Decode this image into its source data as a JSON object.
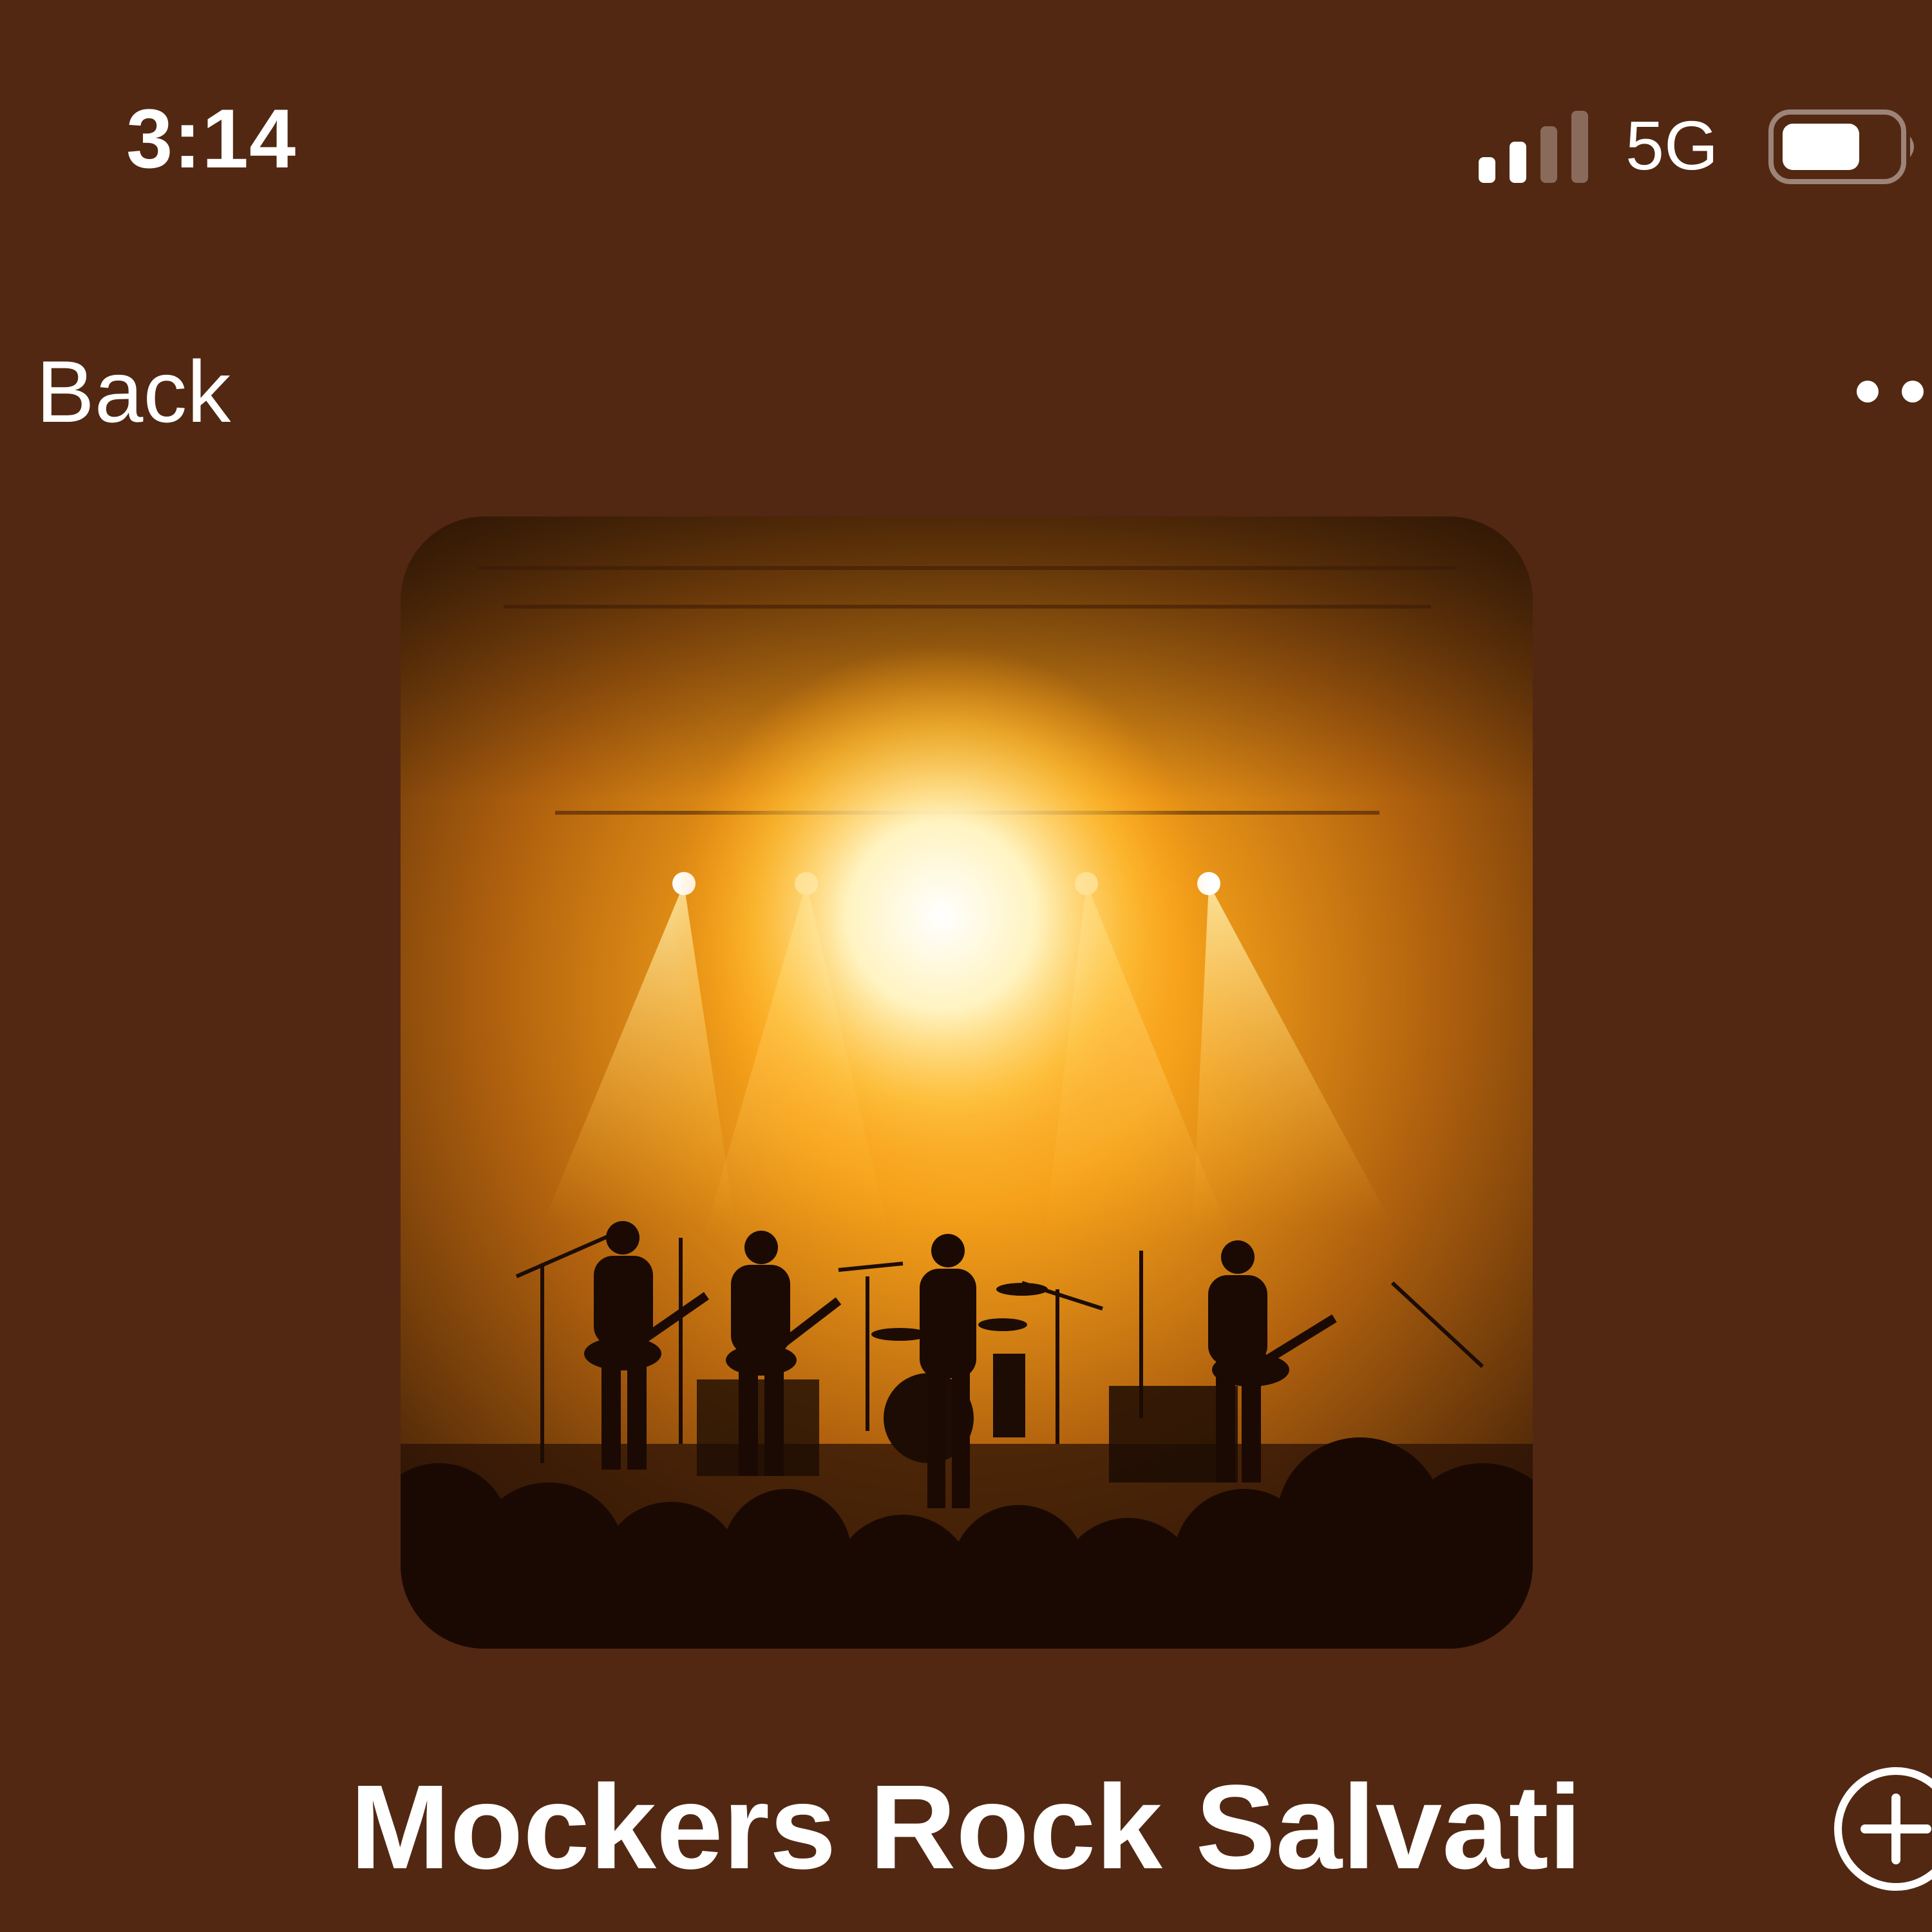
{
  "status_bar": {
    "time": "3:14",
    "network": "5G",
    "signal_bars": 2,
    "signal_total_bars": 4,
    "battery_level": 0.7
  },
  "nav": {
    "back_label": "Back",
    "more_icon": "ellipsis-icon"
  },
  "artwork": {
    "icon": "concert-stage-image"
  },
  "album": {
    "title": "Mockers Rock Salvati",
    "add_icon": "plus-circle-icon"
  },
  "colors": {
    "background": "#522812",
    "text": "#ffffff",
    "stage_light": "#ffb020"
  }
}
